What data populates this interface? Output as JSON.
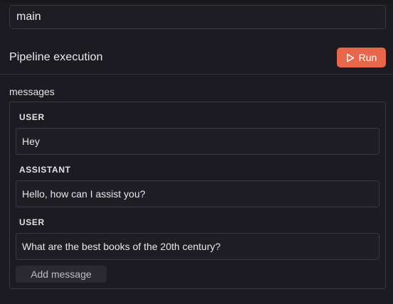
{
  "branch": {
    "value": "main"
  },
  "pipeline": {
    "title": "Pipeline execution",
    "run_label": "Run",
    "accent_color": "#e8674a"
  },
  "messages": {
    "label": "messages",
    "items": [
      {
        "role": "USER",
        "content": "Hey"
      },
      {
        "role": "ASSISTANT",
        "content": "Hello, how can I assist you?"
      },
      {
        "role": "USER",
        "content": "What are the best books of the 20th century?"
      }
    ],
    "add_label": "Add message"
  },
  "icons": {
    "run": "play-icon"
  }
}
